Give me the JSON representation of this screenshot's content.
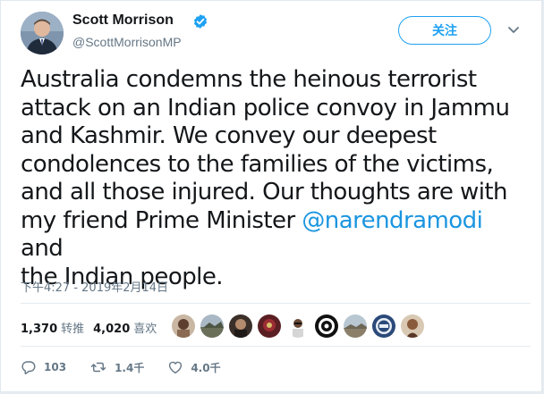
{
  "author": {
    "name": "Scott Morrison",
    "handle": "@ScottMorrisonMP",
    "verified": true
  },
  "follow_label": "关注",
  "tweet": {
    "lines": [
      "Australia condemns the heinous terrorist",
      "attack on an Indian police convoy in Jammu",
      "and Kashmir. We convey our deepest",
      "condolences to the families of the victims,",
      "and all those injured. Our thoughts are with"
    ],
    "line6_before": "my friend Prime Minister ",
    "mention": "@narendramodi",
    "line6_after": " and",
    "line7": "the Indian people."
  },
  "timestamp": "下午4:27 - 2019年2月14日",
  "stats": {
    "retweets_count": "1,370",
    "retweets_label": "转推",
    "likes_count": "4,020",
    "likes_label": "喜欢"
  },
  "actions": {
    "replies": "103",
    "retweets": "1.4千",
    "likes": "4.0千"
  },
  "colors": {
    "accent": "#1da1f2",
    "mention": "#1b95e0",
    "muted": "#657786",
    "text": "#14171a"
  },
  "icons": {
    "verified": "verified-badge-icon",
    "caret": "chevron-down-icon",
    "reply": "reply-icon",
    "retweet": "retweet-icon",
    "like": "heart-icon"
  }
}
